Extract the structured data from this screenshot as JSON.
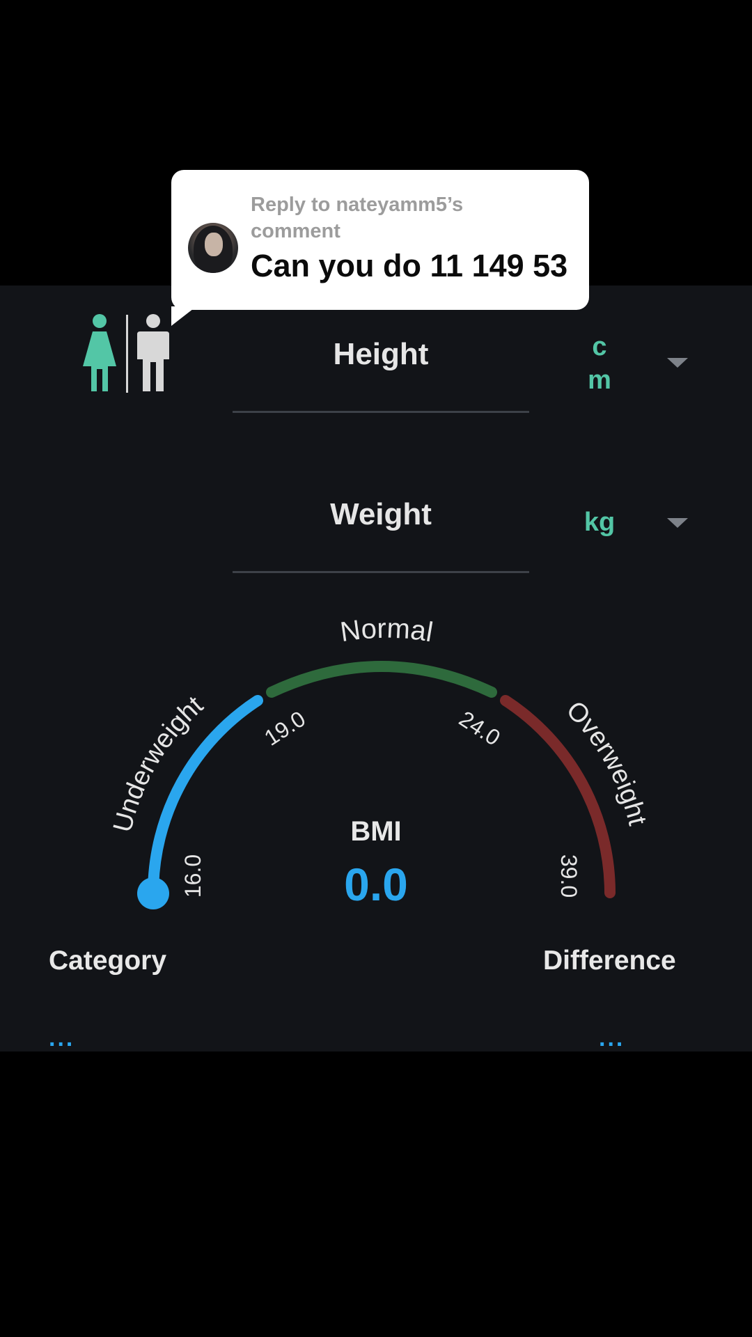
{
  "comment": {
    "reply_line1": "Reply to nateyamm5’s",
    "reply_line2": "comment",
    "text": "Can you do 11 149 53"
  },
  "gender": {
    "female_icon": "female-icon",
    "male_icon": "male-icon",
    "selected": "female",
    "selected_color": "#53c6a6",
    "unselected_color": "#d8d8d8"
  },
  "height": {
    "label": "Height",
    "unit_line1": "c",
    "unit_line2": "m"
  },
  "weight": {
    "label": "Weight",
    "unit": "kg"
  },
  "gauge": {
    "normal_label": "Normal",
    "underweight_label": "Underweight",
    "overweight_label": "Overweight",
    "ticks": [
      "16.0",
      "19.0",
      "24.0",
      "39.0"
    ],
    "colors": {
      "underweight": "#2aa6ee",
      "normal": "#2e6a3c",
      "overweight": "#7a2a2a"
    }
  },
  "bmi": {
    "label": "BMI",
    "value": "0.0"
  },
  "footer": {
    "category_label": "Category",
    "category_value": "...",
    "difference_label": "Difference",
    "difference_value": "..."
  }
}
